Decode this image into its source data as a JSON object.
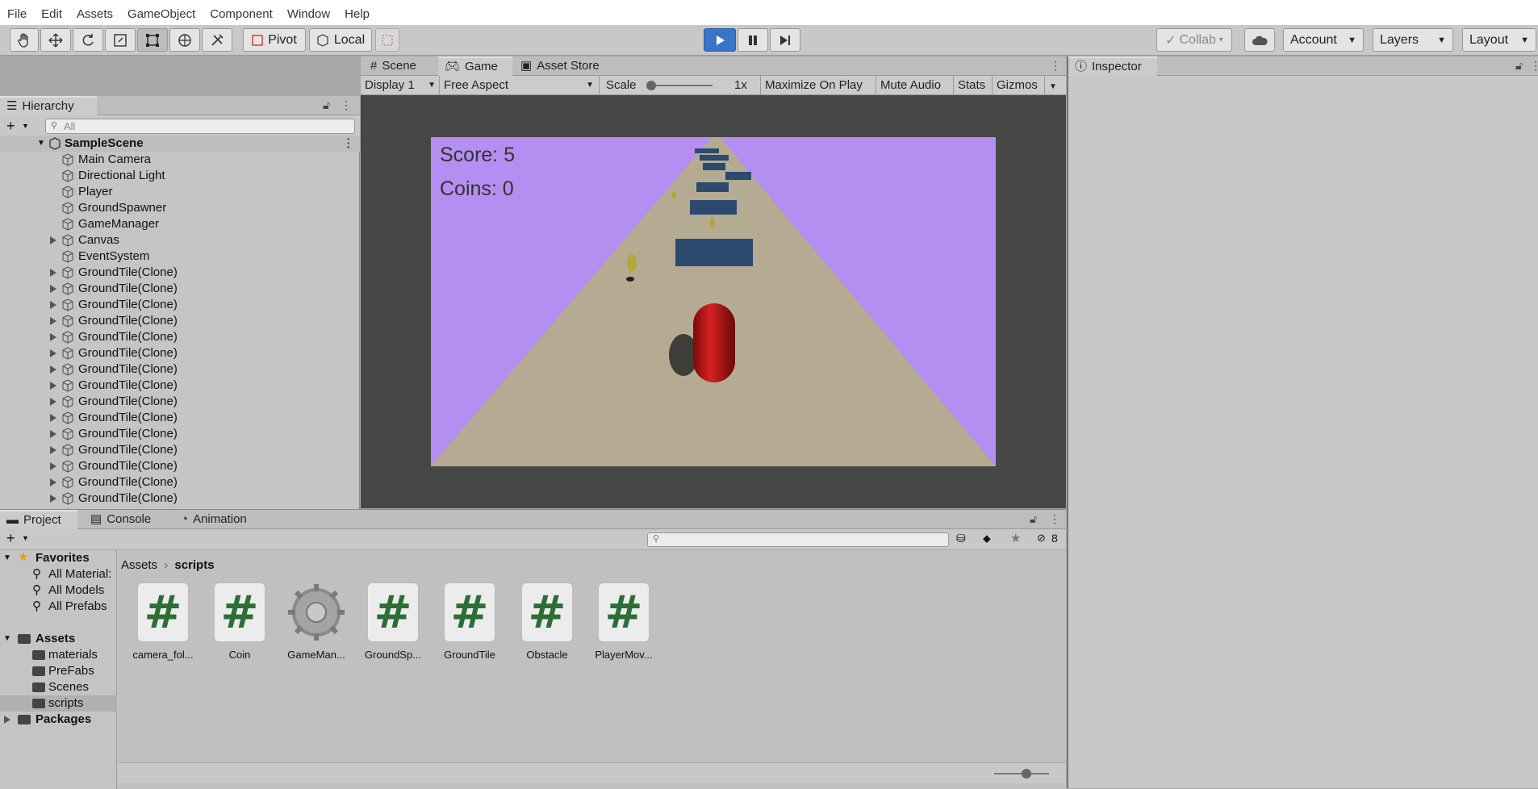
{
  "menu": [
    "File",
    "Edit",
    "Assets",
    "GameObject",
    "Component",
    "Window",
    "Help"
  ],
  "toolbar": {
    "pivot": "Pivot",
    "local": "Local",
    "collab": "Collab",
    "account": "Account",
    "layers": "Layers",
    "layout": "Layout"
  },
  "hierarchy": {
    "tab": "Hierarchy",
    "search_placeholder": "All",
    "scene": "SampleScene",
    "items": [
      "Main Camera",
      "Directional Light",
      "Player",
      "GroundSpawner",
      "GameManager",
      "Canvas",
      "EventSystem",
      "GroundTile(Clone)",
      "GroundTile(Clone)",
      "GroundTile(Clone)",
      "GroundTile(Clone)",
      "GroundTile(Clone)",
      "GroundTile(Clone)",
      "GroundTile(Clone)",
      "GroundTile(Clone)",
      "GroundTile(Clone)",
      "GroundTile(Clone)",
      "GroundTile(Clone)",
      "GroundTile(Clone)",
      "GroundTile(Clone)",
      "GroundTile(Clone)",
      "GroundTile(Clone)",
      "GroundTile(Clone)",
      "GroundTile(Clone)"
    ]
  },
  "center_tabs": [
    "Scene",
    "Game",
    "Asset Store"
  ],
  "game_toolbar": {
    "display": "Display 1",
    "aspect": "Free Aspect",
    "scale_label": "Scale",
    "scale_value": "1x",
    "maximize": "Maximize On Play",
    "mute": "Mute Audio",
    "stats": "Stats",
    "gizmos": "Gizmos"
  },
  "game": {
    "score": "Score: 5",
    "coins": "Coins: 0",
    "sky_color": "#b48ef0",
    "ground_color": "#b5aa92"
  },
  "inspector": {
    "tab": "Inspector"
  },
  "project": {
    "tabs": [
      "Project",
      "Console",
      "Animation"
    ],
    "hidden_count": "8",
    "favorites": "Favorites",
    "fav_items": [
      "All Material:",
      "All Models",
      "All Prefabs"
    ],
    "assets": "Assets",
    "folders": [
      "materials",
      "PreFabs",
      "Scenes",
      "scripts"
    ],
    "packages": "Packages",
    "breadcrumb": [
      "Assets",
      "scripts"
    ],
    "files": [
      "camera_fol...",
      "Coin",
      "GameMan...",
      "GroundSp...",
      "GroundTile",
      "Obstacle",
      "PlayerMov..."
    ]
  }
}
